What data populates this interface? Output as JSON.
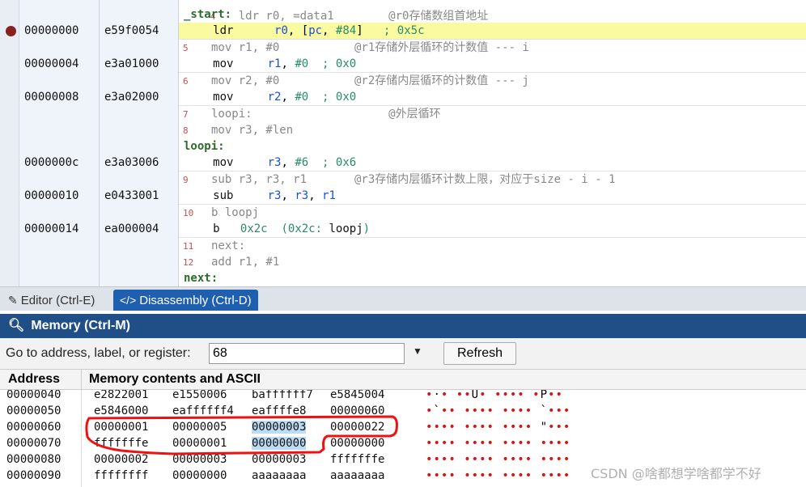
{
  "disasm": {
    "top_partial": "4   ldr r0, =data1        @r0存储数组首地址",
    "rows": [
      {
        "kind": "label",
        "text": "_start:"
      },
      {
        "kind": "ins",
        "addr": "00000000",
        "hex": "e59f0054",
        "bp": true,
        "hl": true,
        "mn": "ldr",
        "ops": "r0, [pc, #84]",
        "cmt": "; 0x5c"
      },
      {
        "kind": "src",
        "ln": "5",
        "text": "mov r1, #0           @r1存储外层循环的计数值 --- i"
      },
      {
        "kind": "ins",
        "addr": "00000004",
        "hex": "e3a01000",
        "mn": "mov",
        "ops": "r1, #0",
        "cmt": "; 0x0"
      },
      {
        "kind": "src",
        "ln": "6",
        "text": "mov r2, #0           @r2存储内层循环的计数值 --- j"
      },
      {
        "kind": "ins",
        "addr": "00000008",
        "hex": "e3a02000",
        "mn": "mov",
        "ops": "r2, #0",
        "cmt": "; 0x0"
      },
      {
        "kind": "src",
        "ln": "7",
        "text": "loopi:                    @外层循环"
      },
      {
        "kind": "src",
        "ln": "8",
        "text": "mov r3, #len"
      },
      {
        "kind": "label",
        "text": "loopi:"
      },
      {
        "kind": "ins",
        "addr": "0000000c",
        "hex": "e3a03006",
        "mn": "mov",
        "ops": "r3, #6",
        "cmt": "; 0x6"
      },
      {
        "kind": "src",
        "ln": "9",
        "text": "sub r3, r3, r1       @r3存储内层循环计数上限，对应于size - i - 1"
      },
      {
        "kind": "ins",
        "addr": "00000010",
        "hex": "e0433001",
        "mn": "sub",
        "ops": "r3, r3, r1",
        "cmt": ""
      },
      {
        "kind": "src",
        "ln": "10",
        "text": "b loopj"
      },
      {
        "kind": "ins",
        "addr": "00000014",
        "hex": "ea000004",
        "mn": "b",
        "ops": "0x2c",
        "cmt": "(0x2c: loopj)"
      },
      {
        "kind": "src",
        "ln": "11",
        "text": "next:"
      },
      {
        "kind": "src",
        "ln": "12",
        "text": "add r1, #1"
      },
      {
        "kind": "label",
        "text": "next:"
      }
    ]
  },
  "tabs": [
    {
      "label": "Editor (Ctrl-E)",
      "icon": "edit-icon",
      "active": false
    },
    {
      "label": "Disassembly (Ctrl-D)",
      "icon": "code-icon",
      "active": true
    }
  ],
  "memory": {
    "title": "Memory (Ctrl-M)",
    "goto_label": "Go to address, label, or register:",
    "goto_value": "68",
    "refresh_label": "Refresh",
    "col_address": "Address",
    "col_contents": "Memory contents and ASCII",
    "rows": [
      {
        "addr": "00000040",
        "w": [
          "e2822001",
          "e1550006",
          "baffffff7",
          "e5845004"
        ],
        "ascii": "•·• ••U• •••• •P••"
      },
      {
        "addr": "00000050",
        "w": [
          "e5846000",
          "eaffffff4",
          "eaffffe8",
          "00000060"
        ],
        "ascii": "•`•• ••••  •••• `•••"
      },
      {
        "addr": "00000060",
        "w": [
          "00000001",
          "00000005",
          "00000003",
          "00000022"
        ],
        "ascii": "•••• •••• •••• \"•••"
      },
      {
        "addr": "00000070",
        "w": [
          "fffffffe",
          "00000001",
          "00000000",
          "00000000"
        ],
        "ascii": "•••• •••• •••• ••••"
      },
      {
        "addr": "00000080",
        "w": [
          "00000002",
          "00000003",
          "00000003",
          "fffffffe"
        ],
        "ascii": "•••• •••• •••• ••••"
      },
      {
        "addr": "00000090",
        "w": [
          "ffffffff",
          "00000000",
          "aaaaaaaa",
          "aaaaaaaa"
        ],
        "ascii": "•••• •••• •••• ••••"
      }
    ]
  },
  "watermark": "CSDN @啥都想学啥都学不好"
}
